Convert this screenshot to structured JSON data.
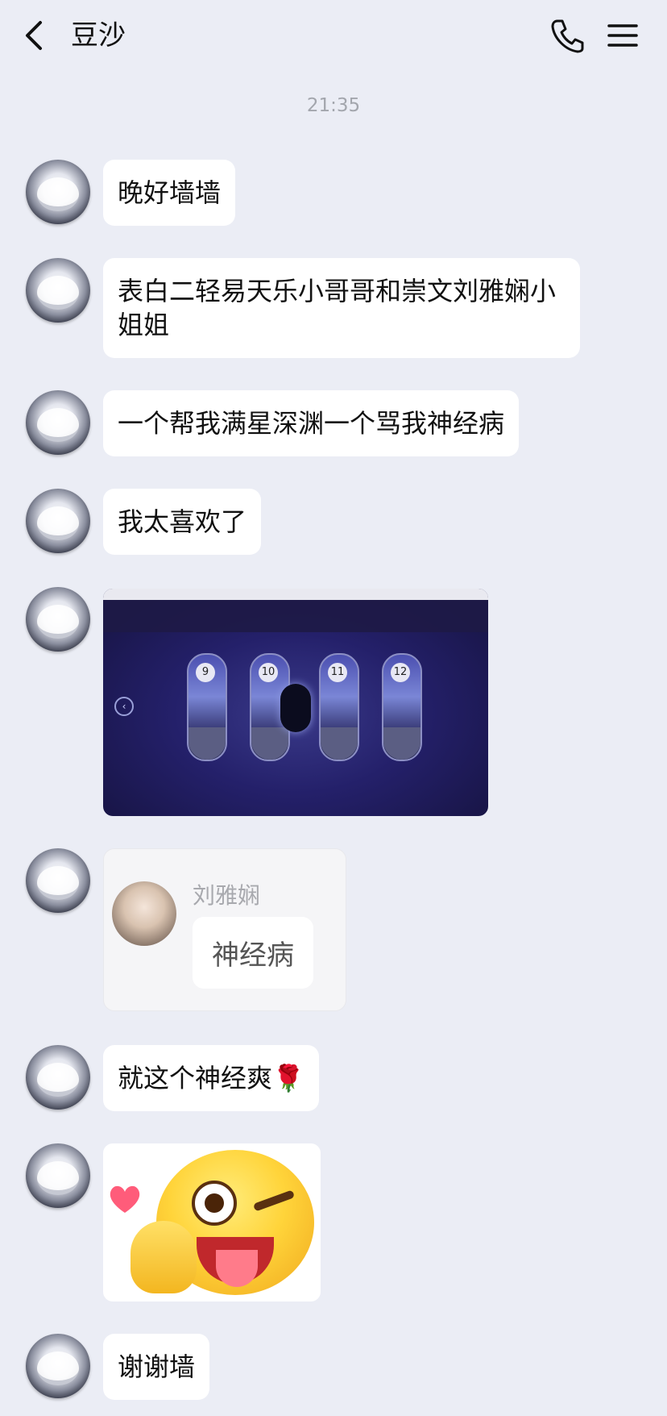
{
  "header": {
    "back_icon": "chevron-left-icon",
    "title": "豆沙",
    "call_icon": "phone-icon",
    "menu_icon": "hamburger-menu-icon"
  },
  "timestamp": "21:35",
  "messages": [
    {
      "type": "text",
      "text": "晚好墙墙"
    },
    {
      "type": "text",
      "text": "表白二轻易天乐小哥哥和崇文刘雅娴小姐姐"
    },
    {
      "type": "text",
      "text": "一个帮我满星深渊一个骂我神经病"
    },
    {
      "type": "text",
      "text": "我太喜欢了"
    },
    {
      "type": "image",
      "description_icon": "game-screenshot-image",
      "cards": [
        "9",
        "10",
        "11",
        "12"
      ]
    },
    {
      "type": "quote",
      "quoted_name": "刘雅娴",
      "quoted_text": "神经病"
    },
    {
      "type": "text",
      "text": "就这个神经爽🌹"
    },
    {
      "type": "sticker",
      "icon": "winking-emoji-sticker"
    },
    {
      "type": "text",
      "text": "谢谢墙"
    }
  ],
  "colors": {
    "background": "#ebedf5",
    "bubble": "#ffffff",
    "text": "#111111",
    "timestamp": "#a3a6ad"
  }
}
